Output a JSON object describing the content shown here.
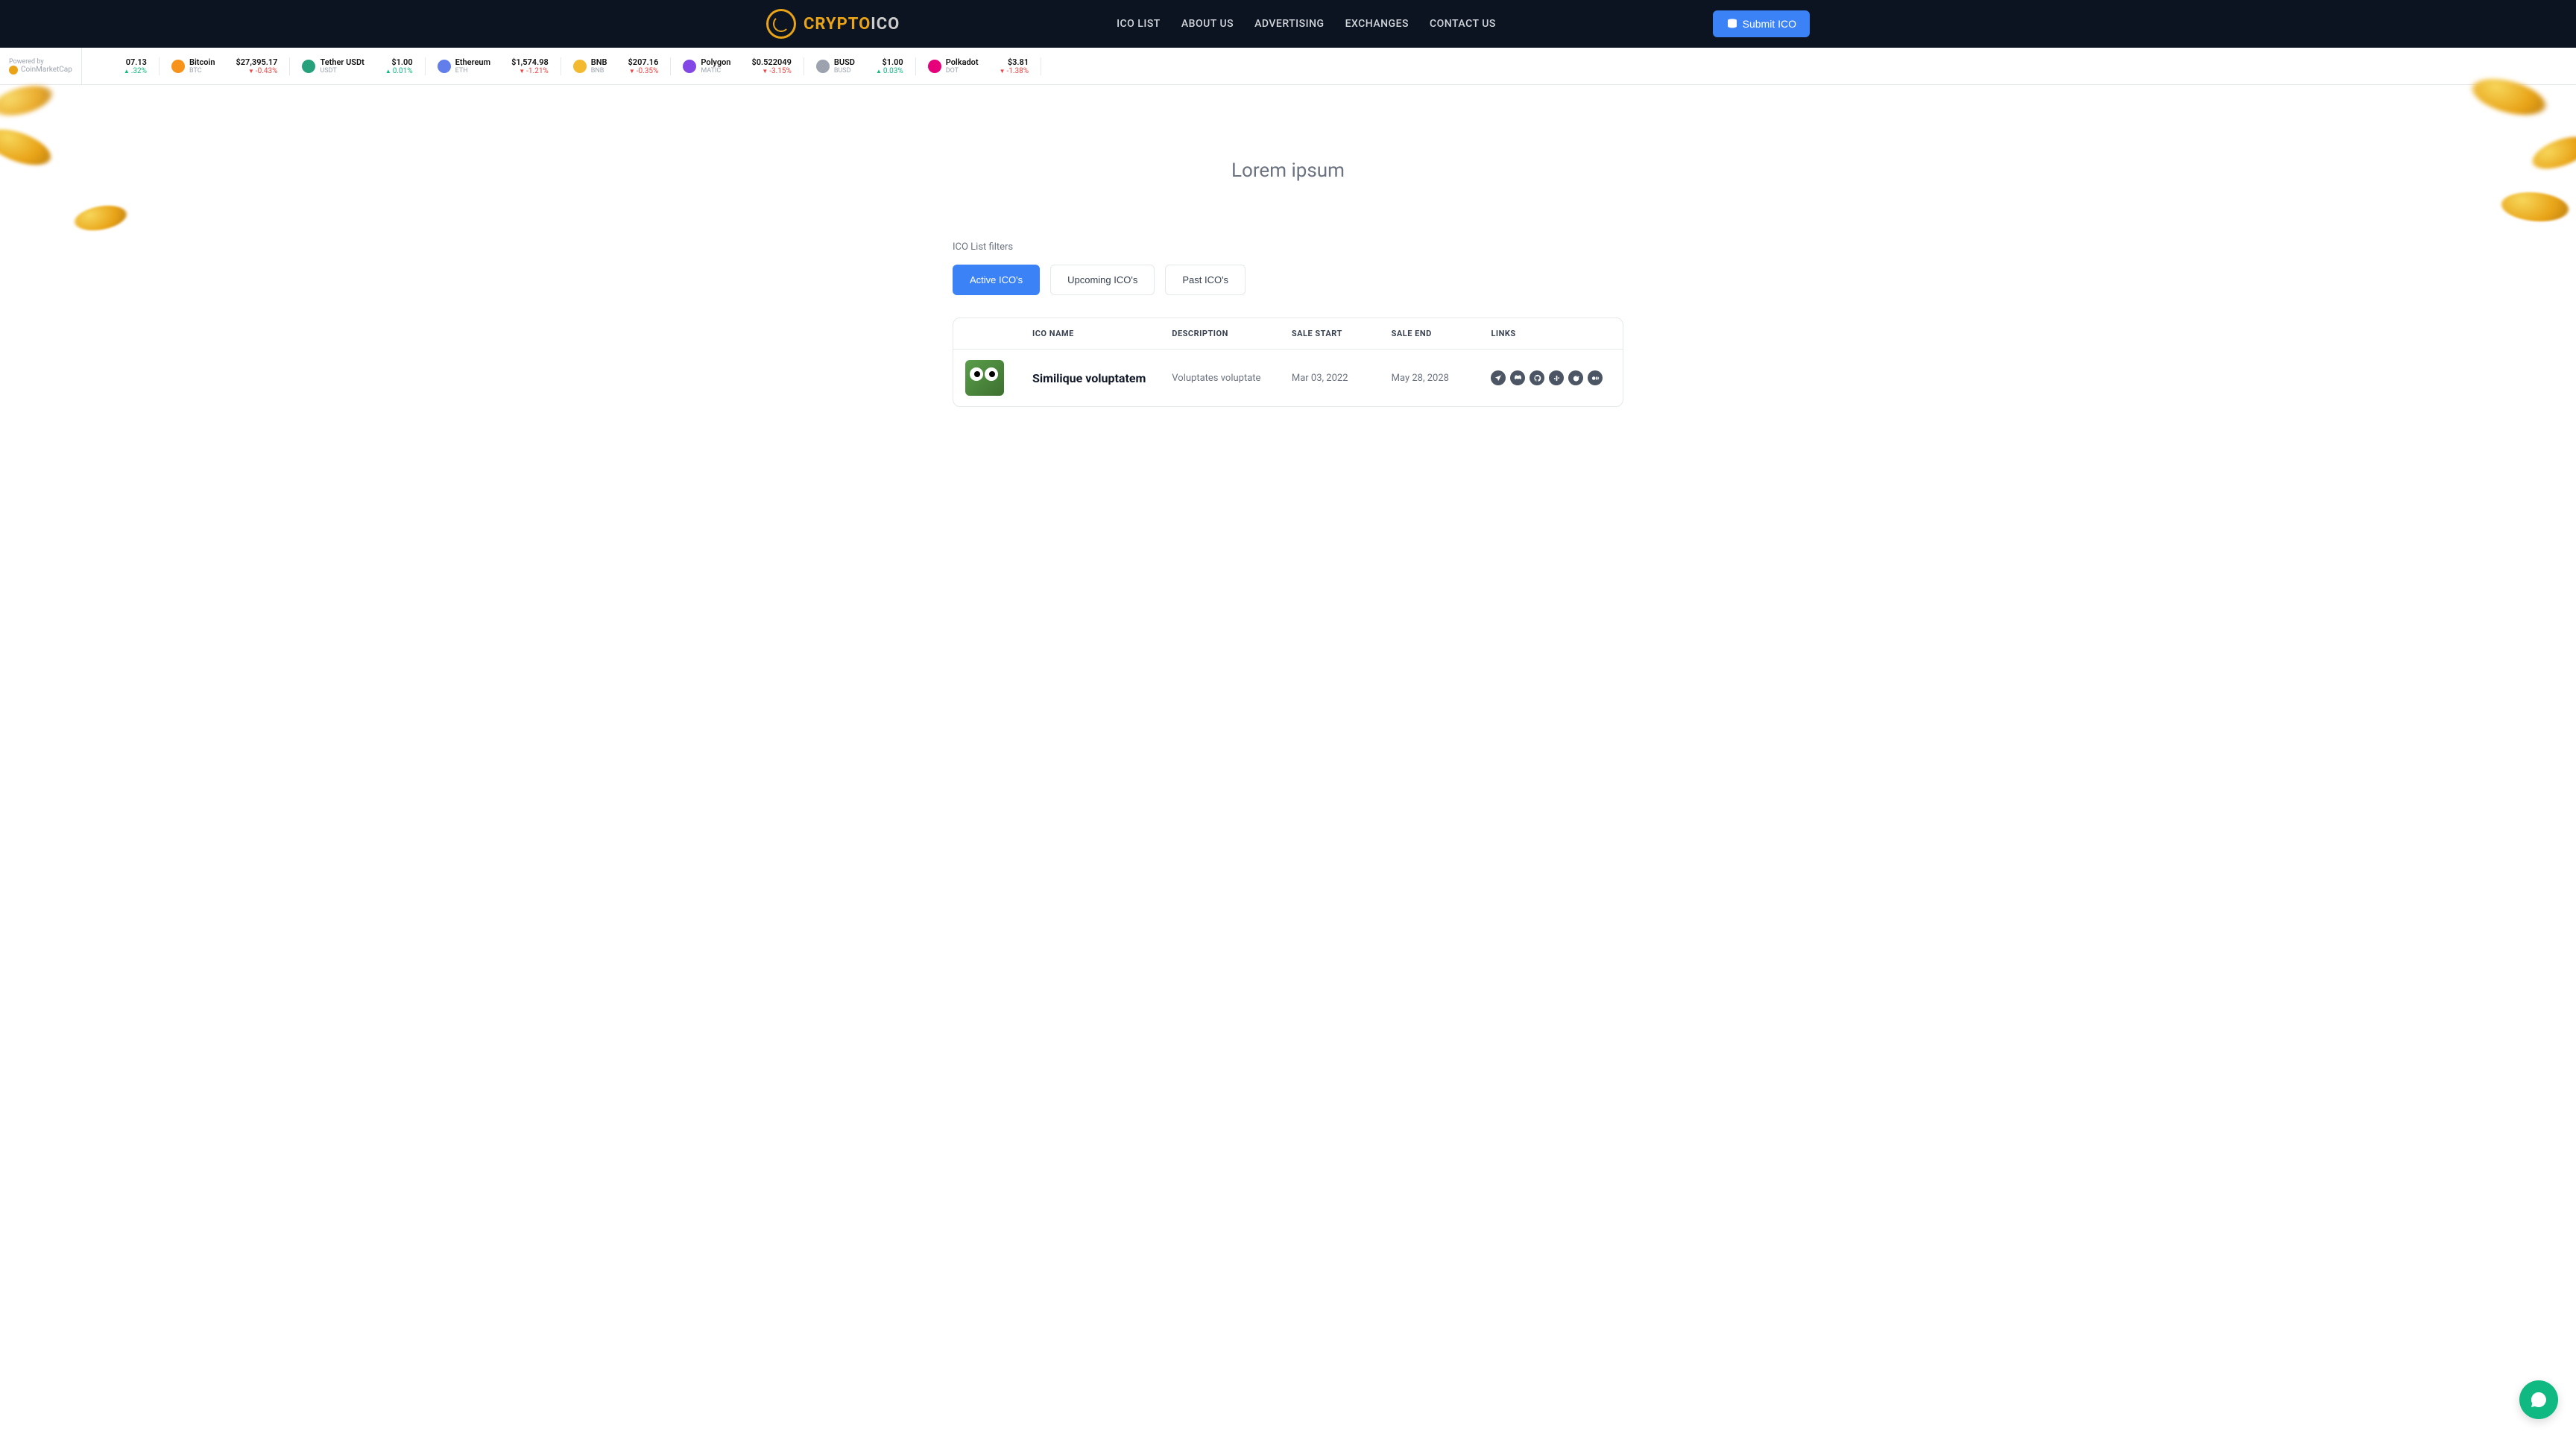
{
  "logo": {
    "part1": "CRYPTO",
    "part2": "ICO"
  },
  "nav": {
    "ico_list": "ICO LIST",
    "about_us": "ABOUT US",
    "advertising": "ADVERTISING",
    "exchanges": "EXCHANGES",
    "contact_us": "CONTACT US"
  },
  "submit_button": "Submit ICO",
  "ticker": {
    "powered_label": "Powered by",
    "powered_name": "CoinMarketCap",
    "items": [
      {
        "name": "",
        "symbol": "",
        "price": "07.13",
        "change": ".32%",
        "direction": "up",
        "color": "#9ca3af"
      },
      {
        "name": "Bitcoin",
        "symbol": "BTC",
        "price": "$27,395.17",
        "change": "-0.43%",
        "direction": "down",
        "color": "#f7931a"
      },
      {
        "name": "Tether USDt",
        "symbol": "USDT",
        "price": "$1.00",
        "change": "0.01%",
        "direction": "up",
        "color": "#26a17b"
      },
      {
        "name": "Ethereum",
        "symbol": "ETH",
        "price": "$1,574.98",
        "change": "-1.21%",
        "direction": "down",
        "color": "#627eea"
      },
      {
        "name": "BNB",
        "symbol": "BNB",
        "price": "$207.16",
        "change": "-0.35%",
        "direction": "down",
        "color": "#f3ba2f"
      },
      {
        "name": "Polygon",
        "symbol": "MATIC",
        "price": "$0.522049",
        "change": "-3.15%",
        "direction": "down",
        "color": "#8247e5"
      },
      {
        "name": "BUSD",
        "symbol": "BUSD",
        "price": "$1.00",
        "change": "0.03%",
        "direction": "up",
        "color": "#9ca3af"
      },
      {
        "name": "Polkadot",
        "symbol": "DOT",
        "price": "$3.81",
        "change": "-1.38%",
        "direction": "down",
        "color": "#e6007a"
      }
    ]
  },
  "page_title": "Lorem ipsum",
  "filters_label": "ICO List filters",
  "filters": {
    "active": "Active ICO's",
    "upcoming": "Upcoming ICO's",
    "past": "Past ICO's"
  },
  "table": {
    "headers": {
      "name": "ICO NAME",
      "description": "DESCRIPTION",
      "sale_start": "SALE START",
      "sale_end": "SALE END",
      "links": "LINKS"
    },
    "rows": [
      {
        "name": "Similique voluptatem",
        "description": "Voluptates voluptate",
        "sale_start": "Mar 03, 2022",
        "sale_end": "May 28, 2028",
        "links": [
          "telegram",
          "discord",
          "github",
          "slack",
          "reddit",
          "medium"
        ]
      }
    ]
  }
}
